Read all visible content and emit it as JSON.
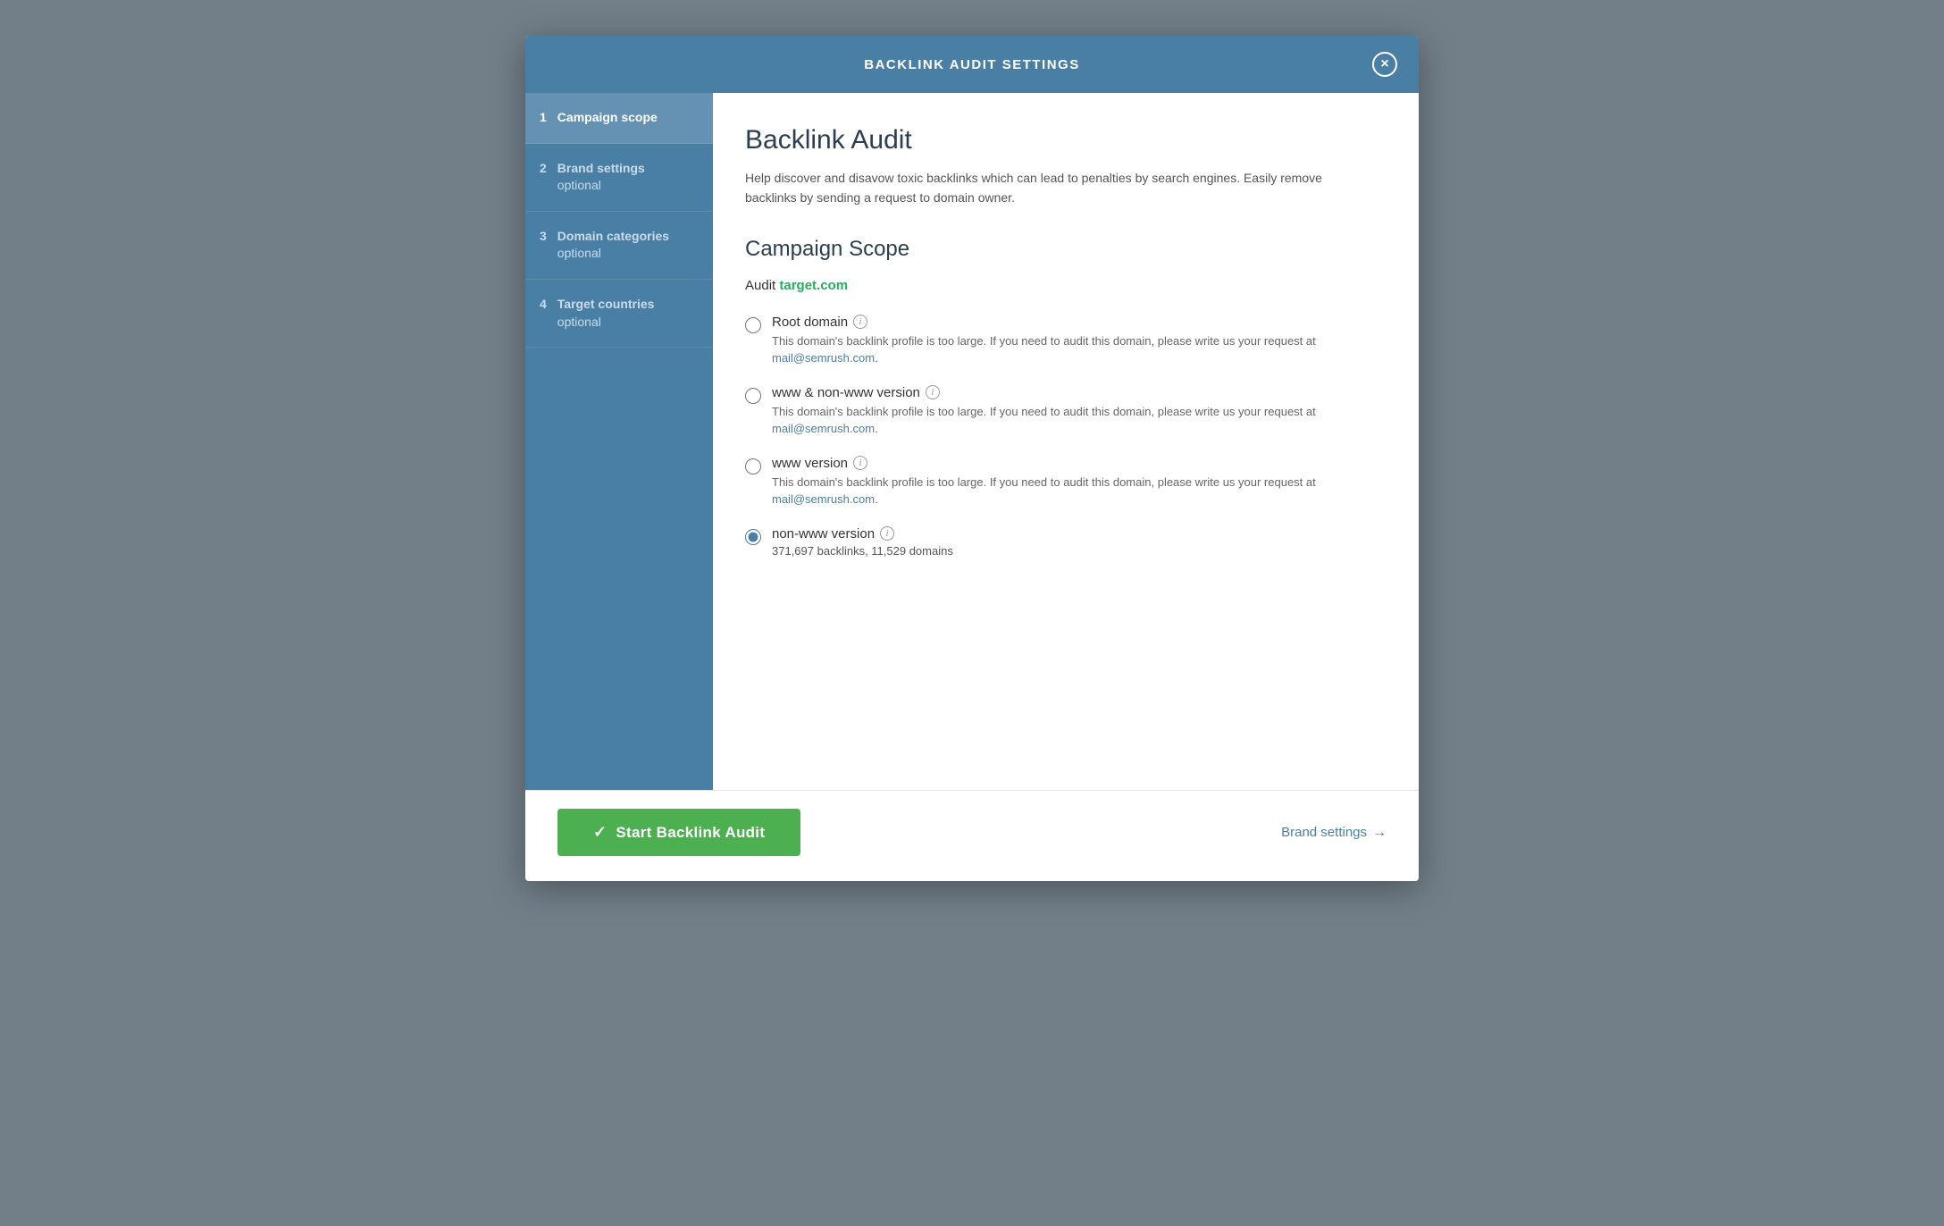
{
  "modal": {
    "header": {
      "title": "BACKLINK AUDIT SETTINGS"
    },
    "close_button_label": "×",
    "sidebar": {
      "items": [
        {
          "number": "1",
          "label": "Campaign scope",
          "sublabel": null,
          "active": true
        },
        {
          "number": "2",
          "label": "Brand settings",
          "sublabel": "optional",
          "active": false
        },
        {
          "number": "3",
          "label": "Domain categories",
          "sublabel": "optional",
          "active": false
        },
        {
          "number": "4",
          "label": "Target countries",
          "sublabel": "optional",
          "active": false
        }
      ]
    },
    "content": {
      "page_title": "Backlink Audit",
      "page_description": "Help discover and disavow toxic backlinks which can lead to penalties by search engines. Easily remove backlinks by sending a request to domain owner.",
      "section_title": "Campaign Scope",
      "audit_label": "Audit",
      "audit_domain": "target.com",
      "radio_options": [
        {
          "id": "root-domain",
          "label": "Root domain",
          "has_info": true,
          "description": "This domain's backlink profile is too large. If you need to audit this domain, please write us your request at",
          "email": "mail@semrush.com",
          "stats": null,
          "selected": false
        },
        {
          "id": "www-non-www",
          "label": "www & non-www version",
          "has_info": true,
          "description": "This domain's backlink profile is too large. If you need to audit this domain, please write us your request at",
          "email": "mail@semrush.com",
          "stats": null,
          "selected": false
        },
        {
          "id": "www-version",
          "label": "www version",
          "has_info": true,
          "description": "This domain's backlink profile is too large. If you need to audit this domain, please write us your request at",
          "email": "mail@semrush.com",
          "stats": null,
          "selected": false
        },
        {
          "id": "non-www-version",
          "label": "non-www version",
          "has_info": true,
          "description": null,
          "email": null,
          "stats": "371,697 backlinks, 11,529 domains",
          "selected": true
        }
      ]
    },
    "footer": {
      "start_button_label": "Start Backlink Audit",
      "brand_settings_label": "Brand settings",
      "brand_settings_arrow": "→"
    }
  }
}
